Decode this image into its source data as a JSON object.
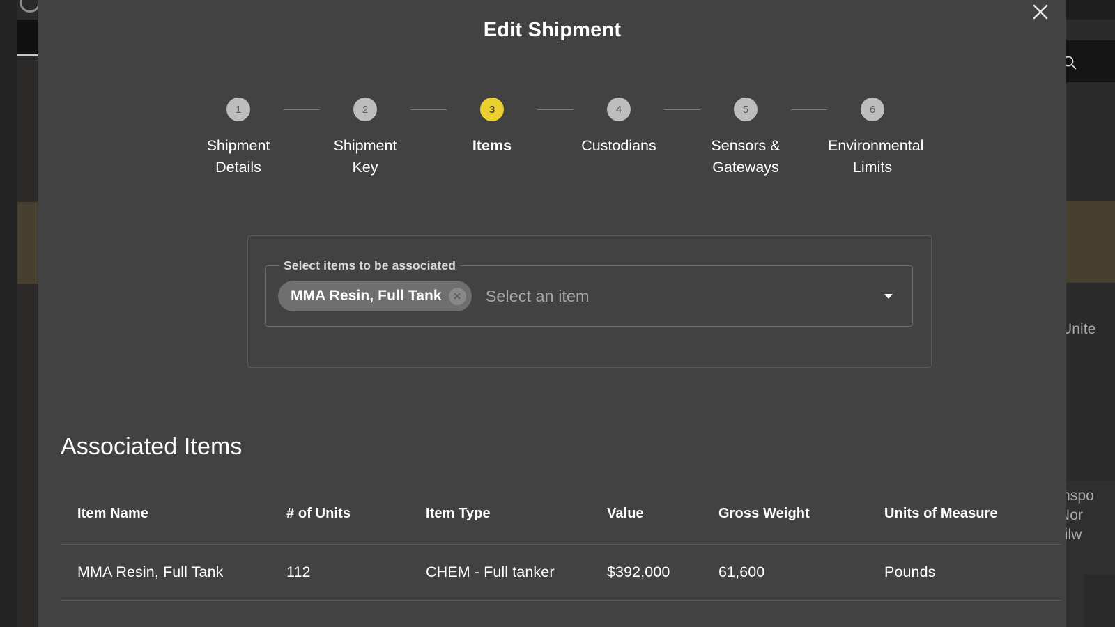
{
  "background": {
    "search_icon": "search-icon",
    "fragment_texts": [
      "Unite",
      "nspo",
      ",Nor",
      "ailw"
    ]
  },
  "modal": {
    "title": "Edit Shipment",
    "close_icon": "close-icon",
    "stepper": {
      "steps": [
        {
          "number": "1",
          "label": "Shipment Details",
          "active": false
        },
        {
          "number": "2",
          "label": "Shipment Key",
          "active": false
        },
        {
          "number": "3",
          "label": "Items",
          "active": true
        },
        {
          "number": "4",
          "label": "Custodians",
          "active": false
        },
        {
          "number": "5",
          "label": "Sensors & Gateways",
          "active": false
        },
        {
          "number": "6",
          "label": "Environmental Limits",
          "active": false
        }
      ],
      "active_color": "#ecd02f",
      "inactive_color": "#bdbdbd"
    },
    "select_section": {
      "legend": "Select items to be associated",
      "placeholder": "Select an item",
      "chips": [
        {
          "label": "MMA Resin, Full Tank",
          "remove_icon": "close-circle-icon"
        }
      ],
      "caret_icon": "chevron-down-icon"
    },
    "associated_items": {
      "heading": "Associated Items",
      "columns": [
        "Item Name",
        "# of Units",
        "Item Type",
        "Value",
        "Gross Weight",
        "Units of Measure"
      ],
      "rows": [
        {
          "item_name": "MMA Resin, Full Tank",
          "units": "112",
          "item_type": "CHEM - Full tanker",
          "value": "$392,000",
          "gross_weight": "61,600",
          "units_of_measure": "Pounds"
        }
      ]
    }
  }
}
